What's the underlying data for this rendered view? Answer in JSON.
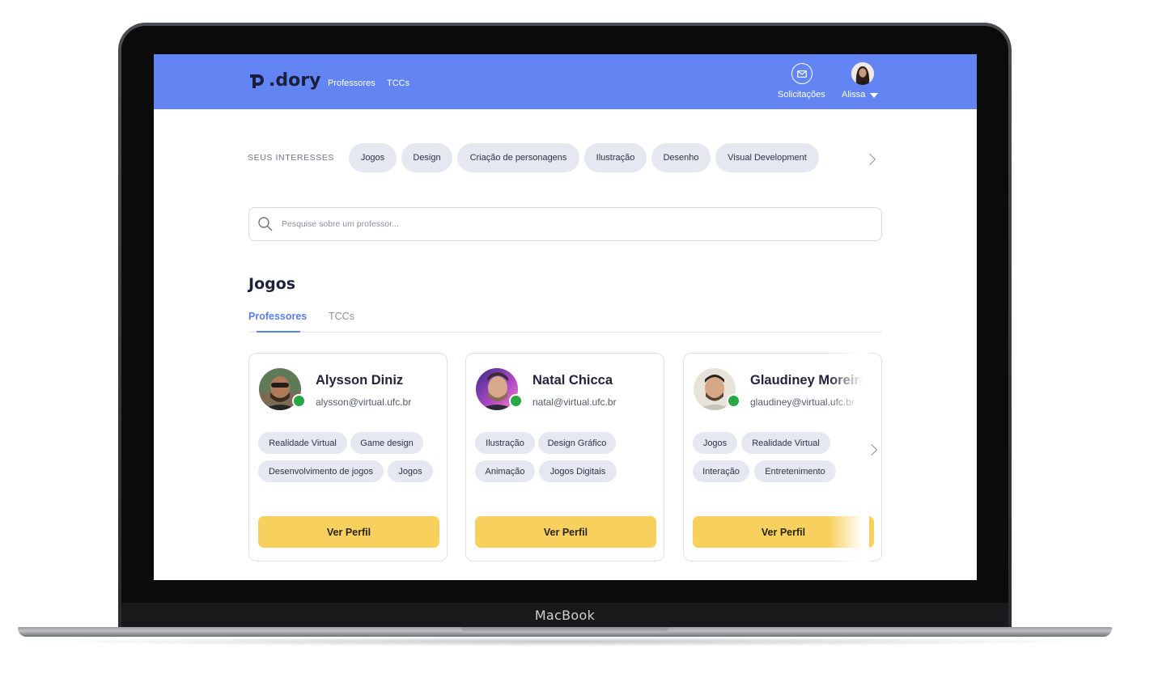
{
  "device": {
    "brand_label": "MacBook"
  },
  "app": {
    "logo_text": ".dory",
    "nav": {
      "professores": "Professores",
      "tccs": "TCCs"
    },
    "requests_label": "Solicitações",
    "user_name": "Alissa"
  },
  "interests": {
    "title": "SEUS INTERESSES",
    "chips": [
      "Jogos",
      "Design",
      "Criação de personagens",
      "Ilustração",
      "Desenho",
      "Visual Development"
    ]
  },
  "search": {
    "placeholder": "Pesquise sobre um professor..."
  },
  "section": {
    "title": "Jogos",
    "tabs": [
      {
        "label": "Professores",
        "active": true
      },
      {
        "label": "TCCs",
        "active": false
      }
    ]
  },
  "cards": [
    {
      "name": "Alysson Diniz",
      "email": "alysson@virtual.ufc.br",
      "status": "online",
      "tags": [
        "Realidade Virtual",
        "Game design",
        "Desenvolvimento de jogos",
        "Jogos"
      ],
      "button": "Ver Perfil"
    },
    {
      "name": "Natal Chicca",
      "email": "natal@virtual.ufc.br",
      "status": "online",
      "tags": [
        "Ilustração",
        "Design Gráfico",
        "Animação",
        "Jogos Digitais"
      ],
      "button": "Ver Perfil"
    },
    {
      "name": "Glaudiney Moreira",
      "email": "glaudiney@virtual.ufc.br",
      "status": "online",
      "tags": [
        "Jogos",
        "Realidade Virtual",
        "Interação",
        "Entretenimento"
      ],
      "button": "Ver Perfil"
    }
  ],
  "colors": {
    "topbar": "#6385f4",
    "accent": "#5a7df0",
    "button": "#f8d05e",
    "online": "#27a844",
    "chip": "#e5e8f0"
  },
  "icons": [
    "logo-mark-icon",
    "envelope-icon",
    "chevron-down-icon",
    "chevron-right-icon",
    "search-icon"
  ]
}
